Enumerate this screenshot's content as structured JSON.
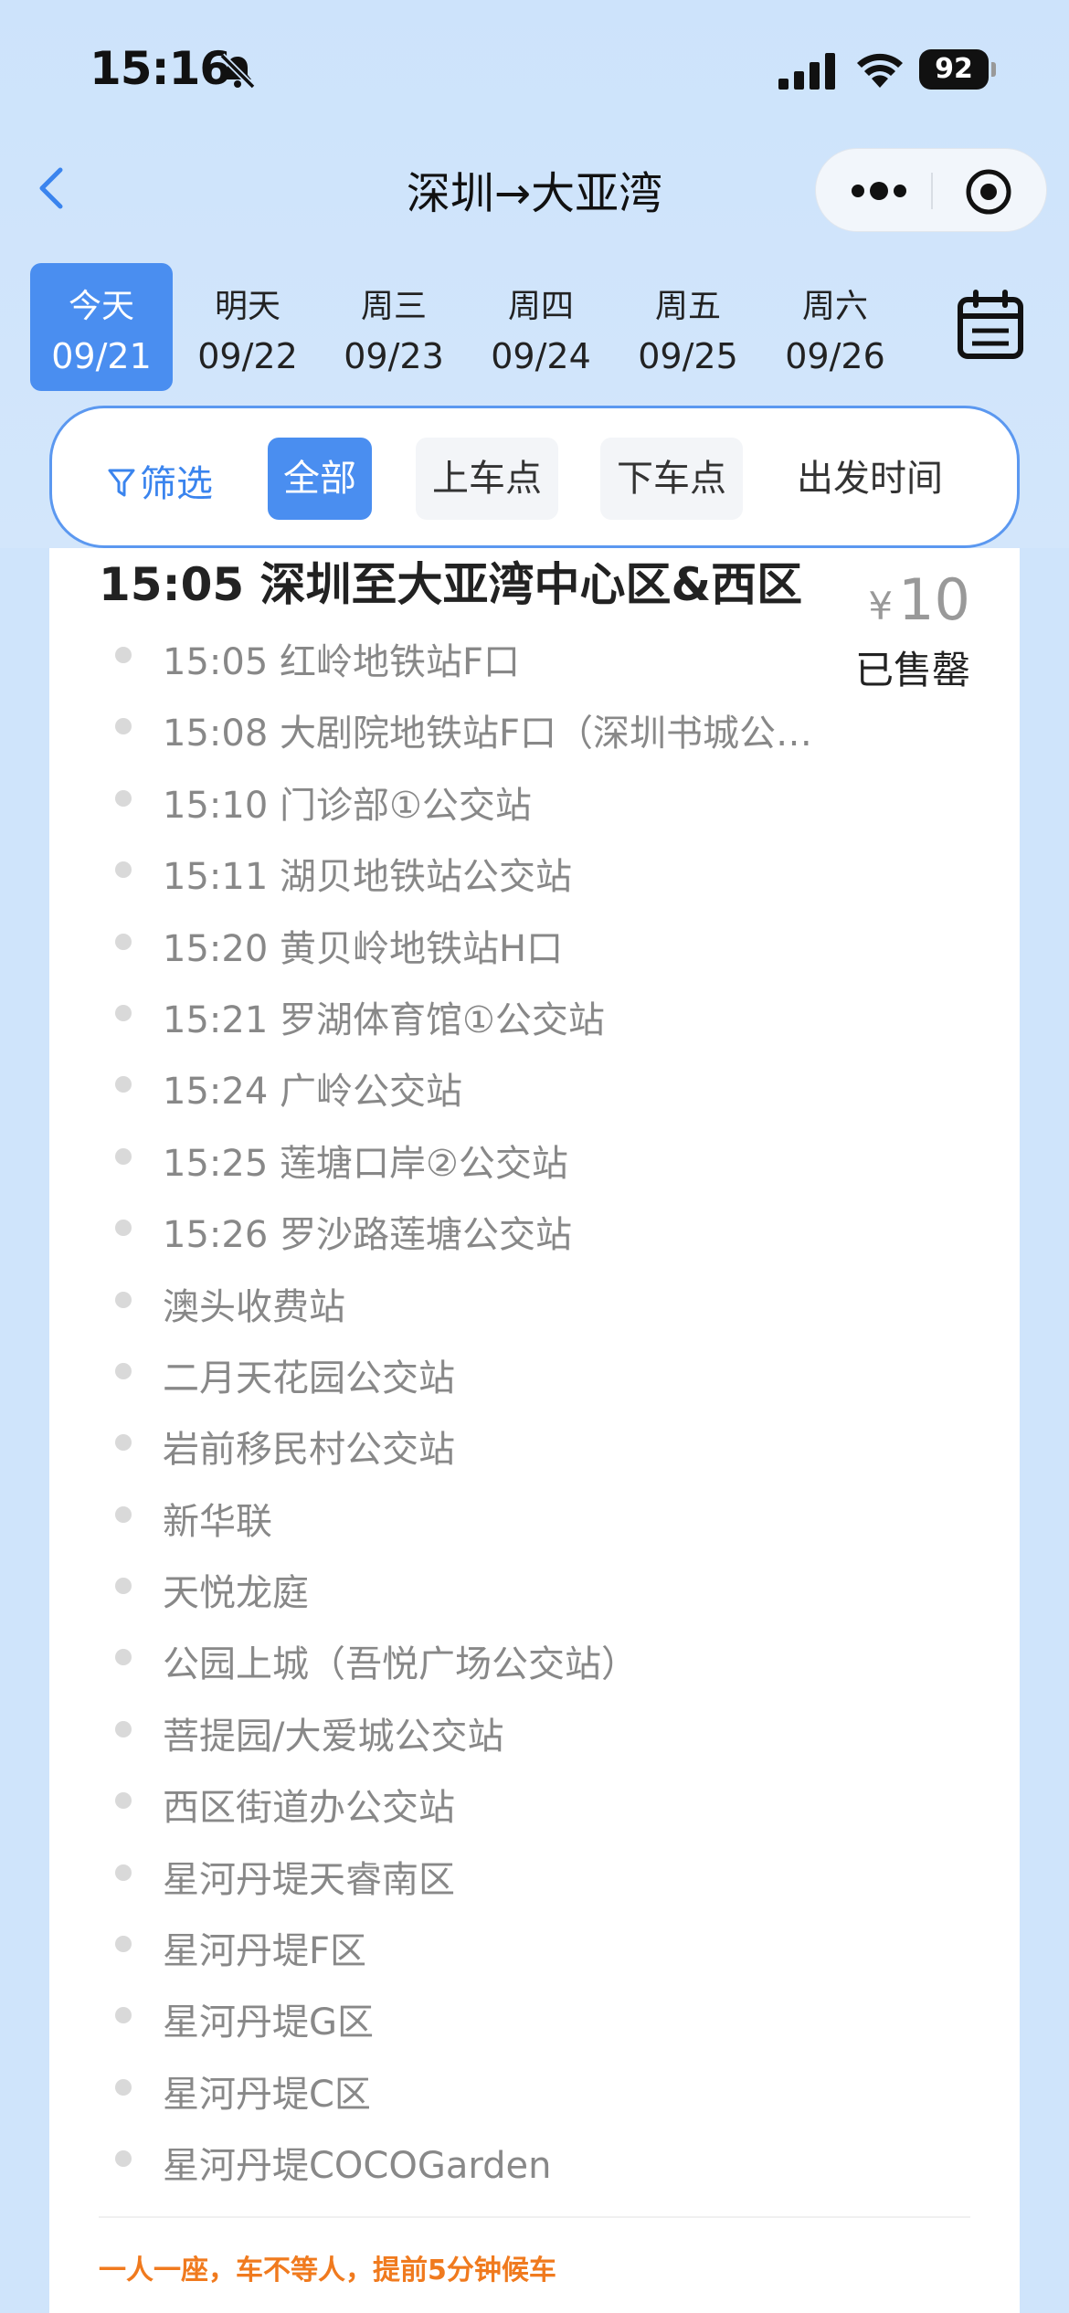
{
  "status_bar": {
    "time": "15:16",
    "battery": "92"
  },
  "nav": {
    "title": "深圳→大亚湾"
  },
  "date_tabs": [
    {
      "dow": "今天",
      "md": "09/21",
      "active": true
    },
    {
      "dow": "明天",
      "md": "09/22"
    },
    {
      "dow": "周三",
      "md": "09/23"
    },
    {
      "dow": "周四",
      "md": "09/24"
    },
    {
      "dow": "周五",
      "md": "09/25"
    },
    {
      "dow": "周六",
      "md": "09/26"
    }
  ],
  "filter": {
    "label": "筛选",
    "chips": [
      "全部",
      "上车点",
      "下车点",
      "出发时间"
    ]
  },
  "trip": {
    "title": "15:05 深圳至大亚湾中心区&西区",
    "currency": "¥",
    "price": "10",
    "status": "已售罄",
    "stops": [
      "15:05 红岭地铁站F口",
      "15:08 大剧院地铁站F口（深圳书城公…",
      "15:10 门诊部①公交站",
      "15:11 湖贝地铁站公交站",
      "15:20 黄贝岭地铁站H口",
      "15:21 罗湖体育馆①公交站",
      "15:24 广岭公交站",
      "15:25 莲塘口岸②公交站",
      "15:26 罗沙路莲塘公交站",
      "澳头收费站",
      "二月天花园公交站",
      "岩前移民村公交站",
      "新华联",
      "天悦龙庭",
      "公园上城（吾悦广场公交站）",
      "菩提园/大爱城公交站",
      "西区街道办公交站",
      "星河丹堤天睿南区",
      "星河丹堤F区",
      "星河丹堤G区",
      "星河丹堤C区",
      "星河丹堤COCOGarden"
    ],
    "notice": "一人一座，车不等人，提前5分钟候车"
  }
}
